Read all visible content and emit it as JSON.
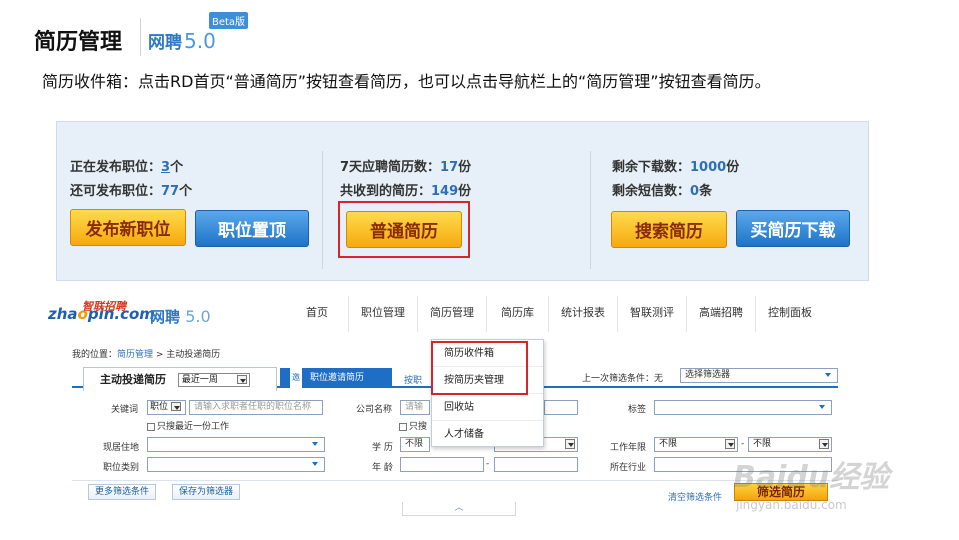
{
  "header": {
    "title": "简历管理",
    "logo_name": "网聘",
    "logo_version": "5.0",
    "beta": "Beta版"
  },
  "description": "简历收件箱：点击RD首页“普通简历”按钮查看简历，也可以点击导航栏上的“简历管理”按钮查看简历。",
  "panel": {
    "col1": [
      {
        "label": "正在发布职位：",
        "value": "3",
        "unit": "个"
      },
      {
        "label": "还可发布职位：",
        "value": "77",
        "unit": "个"
      }
    ],
    "col2": [
      {
        "label": "7天应聘简历数：",
        "value": "17",
        "unit": "份"
      },
      {
        "label": "共收到的简历：",
        "value": "149",
        "unit": "份"
      }
    ],
    "col3": [
      {
        "label": "剩余下载数：",
        "value": "1000",
        "unit": "份"
      },
      {
        "label": "剩余短信数：",
        "value": "0",
        "unit": "条"
      }
    ],
    "buttons": {
      "publish": "发布新职位",
      "top": "职位置顶",
      "normal": "普通简历",
      "search": "搜索简历",
      "buy": "买简历下载"
    }
  },
  "site": {
    "logo_text_1": "zha",
    "logo_text_o": "o",
    "logo_text_2": "pin.com",
    "logo_cn": "智联招聘",
    "logo_name": "网聘",
    "logo_version": "5.0",
    "nav": [
      "首页",
      "职位管理",
      "简历管理",
      "简历库",
      "统计报表",
      "智联测评",
      "高端招聘",
      "控制面板"
    ],
    "crumb_prefix": "我的位置：",
    "crumb_link": "简历管理",
    "crumb_sep": " > ",
    "crumb_current": "主动投递简历",
    "tab_active": "主动投递简历",
    "tab_active_select": "最近一周",
    "tab_invite_icon": "邀",
    "tab_invite": "职位邀请简历",
    "tab_third": "按职",
    "last_filter_label": "上一次筛选条件：无",
    "filter_select": "选择筛选器",
    "fields": {
      "keyword_label": "关键词",
      "keyword_type": "职位",
      "keyword_placeholder": "请输入求职者任职的职位名称",
      "only_recent_1": "只搜最近一份工作",
      "company_label": "公司名称",
      "company_placeholder": "请输",
      "only_recent_2": "只搜",
      "tag_label": "标签",
      "residence_label": "现居住地",
      "education_label": "学  历",
      "education_value": "不限",
      "education_value_2": "不限",
      "work_years_label": "工作年限",
      "work_years_from": "不限",
      "work_years_to": "不限",
      "position_type_label": "职位类别",
      "age_label": "年  龄",
      "industry_label": "所在行业"
    },
    "more_filters": "更多筛选条件",
    "save_filter": "保存为筛选器",
    "clear_filter": "清空筛选条件",
    "filter_button": "筛选简历",
    "toggle": "︿",
    "menu": [
      "简历收件箱",
      "按简历夹管理",
      "回收站",
      "人才储备"
    ]
  },
  "watermark": {
    "main": "Baidu经验",
    "sub": "jingyan.baidu.com"
  }
}
